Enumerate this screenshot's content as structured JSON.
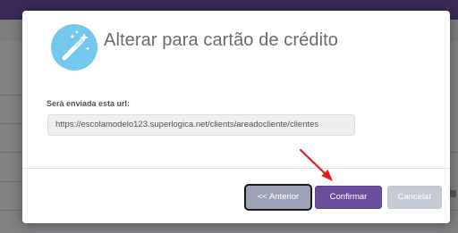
{
  "modal": {
    "title": "Alterar para cartão de crédito",
    "url_label": "Será enviada esta url:",
    "url_value": "https://escolamodelo123.superlogica.net/clients/areadocliente/clientes"
  },
  "buttons": {
    "previous_label": "<< Anterior",
    "confirm_label": "Confirmar",
    "cancel_label": "Cancelar"
  },
  "icons": {
    "header_icon": "magic-wand-icon",
    "annotation": "red-arrow-annotation"
  },
  "colors": {
    "accent": "#6a4e9c",
    "icon_circle": "#74c8ee",
    "annotation": "#e8191c"
  }
}
